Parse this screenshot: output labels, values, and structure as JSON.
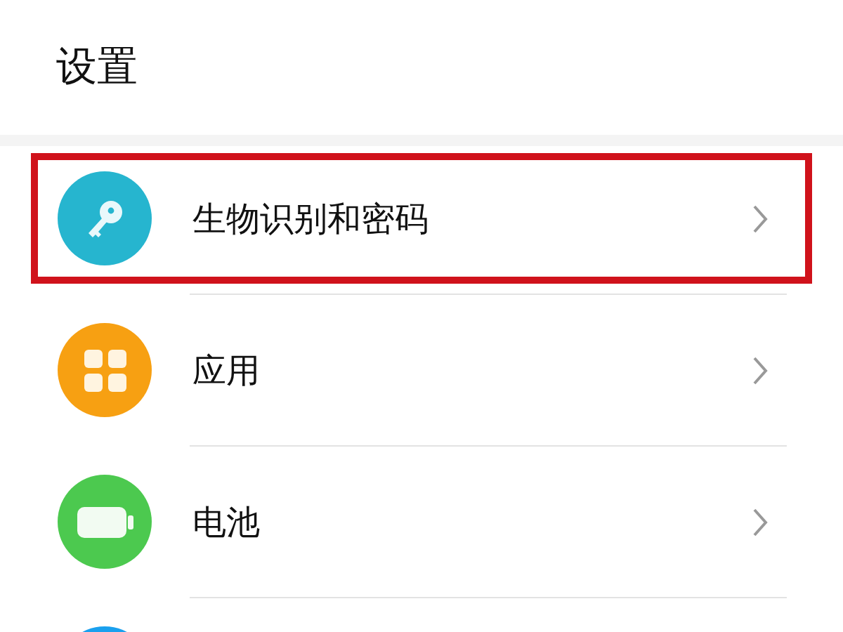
{
  "header": {
    "title": "设置"
  },
  "items": [
    {
      "label": "生物识别和密码",
      "kind": "key",
      "color": "#26b5cf",
      "highlighted": true
    },
    {
      "label": "应用",
      "kind": "apps",
      "color": "#f7a012",
      "highlighted": false
    },
    {
      "label": "电池",
      "kind": "battery",
      "color": "#4cc94f",
      "highlighted": false
    },
    {
      "kind": "partial",
      "color": "#1aa0ee",
      "highlighted": false
    }
  ]
}
